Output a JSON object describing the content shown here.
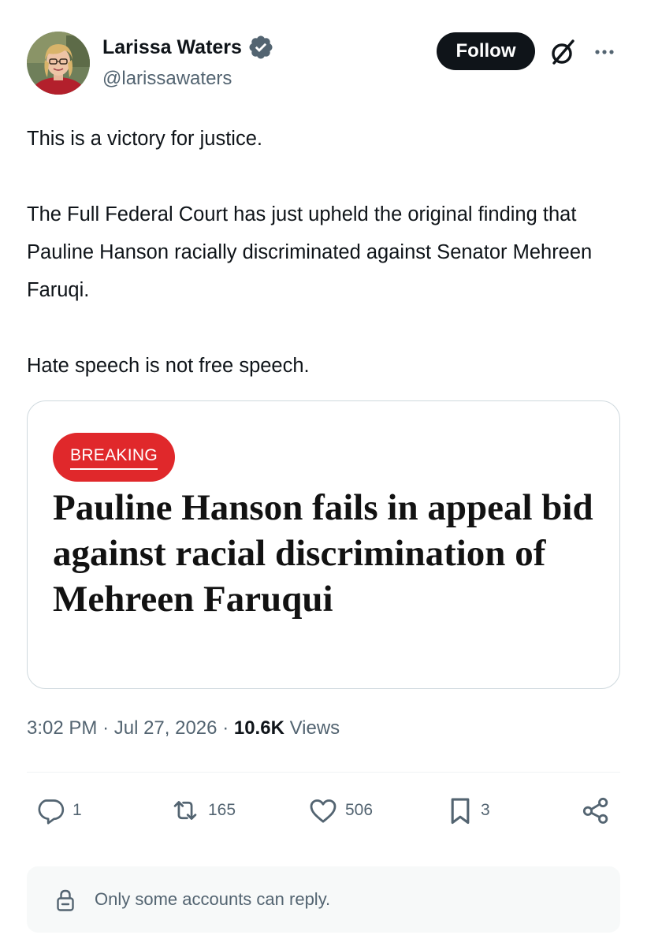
{
  "author": {
    "name": "Larissa Waters",
    "handle": "@larissawaters",
    "verified": true,
    "avatar_icon": "person-photo"
  },
  "header": {
    "follow_label": "Follow",
    "grok_icon": "grok-slash-circle-icon",
    "more_icon": "ellipsis-icon"
  },
  "tweet": {
    "paragraphs": [
      "This is a victory for justice.",
      "The Full Federal Court has just upheld the original finding that Pauline Hanson racially discriminated against Senator Mehreen Faruqi.",
      "Hate speech is not free speech."
    ]
  },
  "card": {
    "badge": "BREAKING",
    "badge_color": "#e0282b",
    "headline": "Pauline Hanson fails in appeal bid against racial discrimination of Mehreen Faruqui"
  },
  "meta": {
    "time": "3:02 PM",
    "date": "Jul 27, 2026",
    "views_count": "10.6K",
    "views_label": "Views"
  },
  "actions": {
    "replies": "1",
    "reposts": "165",
    "likes": "506",
    "bookmarks": "3"
  },
  "reply_restriction": {
    "text": "Only some accounts can reply."
  },
  "colors": {
    "primary_text": "#0f1419",
    "secondary_text": "#536471",
    "verified_blue": "#536471",
    "border": "#cfd9de"
  }
}
